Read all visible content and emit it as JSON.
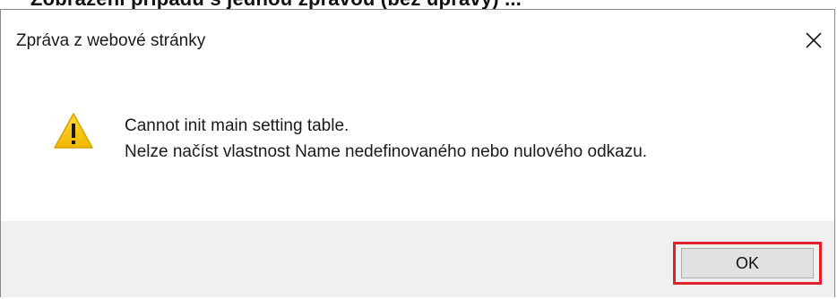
{
  "page": {
    "background_text": "Zobrazení případu s jednou zprávou (bez úpravy) ..."
  },
  "dialog": {
    "title": "Zpráva z webové stránky",
    "close_icon": "close-icon",
    "icon": "warning-icon",
    "message_lines": [
      "Cannot init main setting table.",
      "Nelze načíst vlastnost Name nedefinovaného nebo nulového odkazu."
    ],
    "ok_label": "OK"
  },
  "colors": {
    "warning_fill": "#f7c500",
    "highlight_border": "#e0202a",
    "footer_background": "#f0f0f0"
  }
}
